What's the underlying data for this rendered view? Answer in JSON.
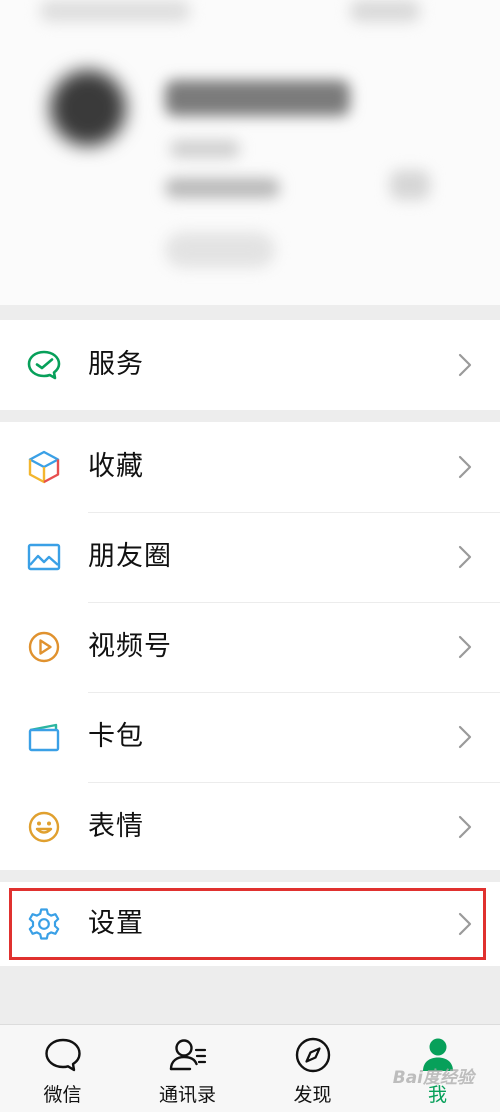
{
  "menu": {
    "services": {
      "label": "服务",
      "icon": "services-icon"
    },
    "favorites": {
      "label": "收藏",
      "icon": "favorites-icon"
    },
    "moments": {
      "label": "朋友圈",
      "icon": "moments-icon"
    },
    "channels": {
      "label": "视频号",
      "icon": "channels-icon"
    },
    "cards": {
      "label": "卡包",
      "icon": "cards-icon"
    },
    "stickers": {
      "label": "表情",
      "icon": "stickers-icon"
    },
    "settings": {
      "label": "设置",
      "icon": "settings-icon"
    }
  },
  "tabs": [
    {
      "label": "微信",
      "icon": "chats-icon",
      "active": false
    },
    {
      "label": "通讯录",
      "icon": "contacts-icon",
      "active": false
    },
    {
      "label": "发现",
      "icon": "discover-icon",
      "active": false
    },
    {
      "label": "我",
      "icon": "me-icon",
      "active": true
    }
  ],
  "watermark": "Bai度经验",
  "colors": {
    "accent_green": "#07a05a",
    "highlight_red": "#e0312f",
    "moments_blue": "#3aa0e6",
    "channels_orange": "#e0922f"
  }
}
